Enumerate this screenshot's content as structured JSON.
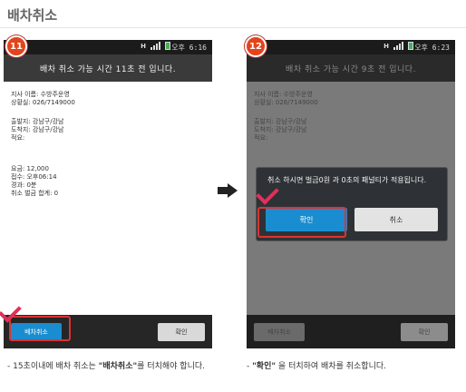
{
  "page_title": "배차취소",
  "steps": [
    "11",
    "12"
  ],
  "status": {
    "net_label": "H",
    "time1": "오후 6:16",
    "time2": "오후 6:23"
  },
  "screen1": {
    "header": "배차 취소 가능 시간 11초 전 입니다.",
    "lines": [
      "지사 이름: 수방주운영",
      "상황실: 026/7149000",
      "출발지: 강남구/강남",
      "도착지: 강남구/강남",
      "적요:",
      "요금: 12,000",
      "접수: 오후06:14",
      "경과: 0분",
      "취소 벌금 합계: 0"
    ],
    "btn_left": "배차취소",
    "btn_right": "확인"
  },
  "screen2": {
    "header": "배차 취소 가능 시간 9초 전 입니다.",
    "lines": [
      "지사 이름: 수방주운영",
      "상황실: 026/7149000",
      "출발지: 강남구/강남",
      "도착지: 강남구/강남",
      "적요:"
    ],
    "dialog_msg": "취소 하시면 벌금0원 과 0초의 패널티가 적용됩니다.",
    "dialog_ok": "확인",
    "dialog_cancel": "취소",
    "btn_left": "배차취소",
    "btn_right": "확인"
  },
  "caption1": {
    "prefix": "- 15초이내에 배차 취소는 ",
    "bold": "\"배차취소\"",
    "suffix": "를 터치해야 합니다."
  },
  "caption2": {
    "prefix": "- ",
    "bold": "\"확인\"",
    "suffix": " 을 터치하여 배차를 취소합니다."
  },
  "colors": {
    "accent": "#1a8dd0",
    "highlight": "#dd3333",
    "step": "#e2441c"
  }
}
